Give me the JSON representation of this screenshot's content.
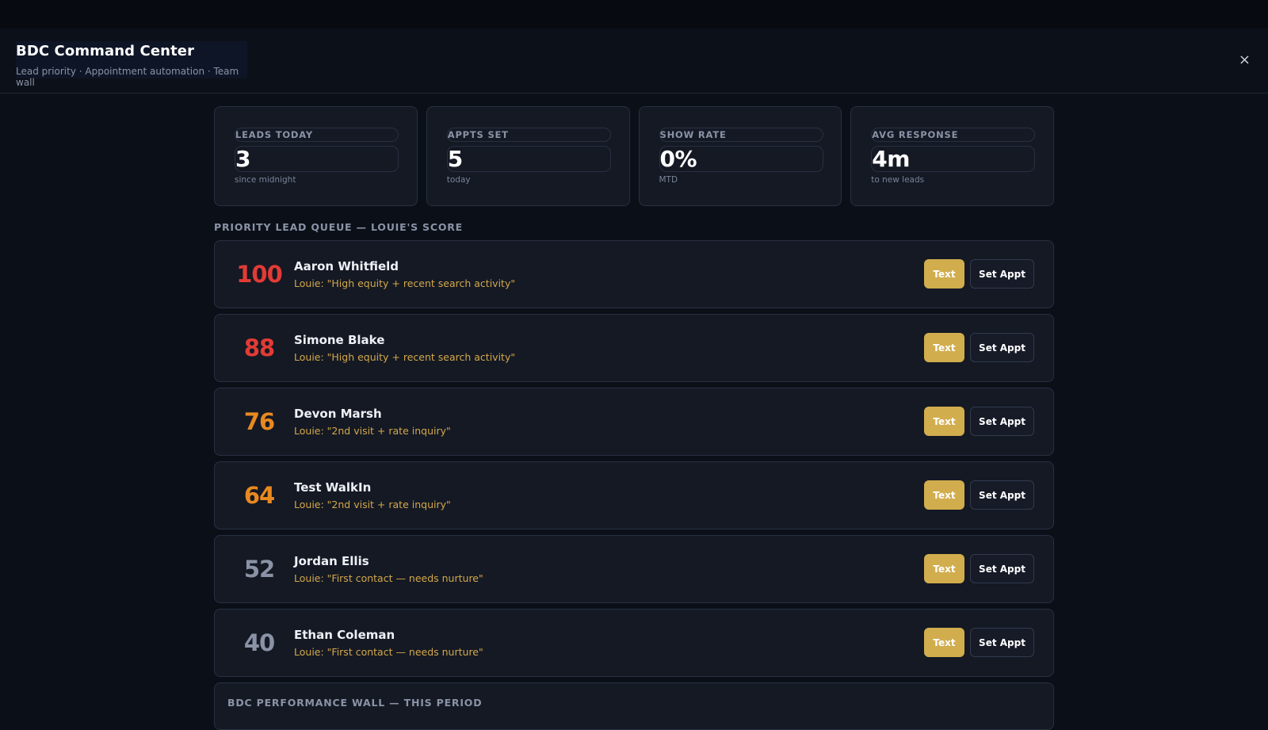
{
  "header": {
    "title": "BDC Command Center",
    "subtitle": "Lead priority · Appointment automation · Team wall",
    "close_icon": "×"
  },
  "stats": [
    {
      "label": "LEADS TODAY",
      "value": "3",
      "sub": "since midnight"
    },
    {
      "label": "APPTS SET",
      "value": "5",
      "sub": "today"
    },
    {
      "label": "SHOW RATE",
      "value": "0%",
      "sub": "MTD"
    },
    {
      "label": "AVG RESPONSE",
      "value": "4m",
      "sub": "to new leads"
    }
  ],
  "queue": {
    "title": "PRIORITY LEAD QUEUE — LOUIE'S SCORE",
    "text_label": "Text",
    "appt_label": "Set Appt",
    "leads": [
      {
        "score": "100",
        "name": "Aaron Whitfield",
        "note": "Louie: \"High equity + recent search activity\"",
        "color": "#e23b35"
      },
      {
        "score": "88",
        "name": "Simone Blake",
        "note": "Louie: \"High equity + recent search activity\"",
        "color": "#e23b35"
      },
      {
        "score": "76",
        "name": "Devon Marsh",
        "note": "Louie: \"2nd visit + rate inquiry\"",
        "color": "#e8891f"
      },
      {
        "score": "64",
        "name": "Test WalkIn",
        "note": "Louie: \"2nd visit + rate inquiry\"",
        "color": "#e8891f"
      },
      {
        "score": "52",
        "name": "Jordan Ellis",
        "note": "Louie: \"First contact — needs nurture\"",
        "color": "#8a93a6"
      },
      {
        "score": "40",
        "name": "Ethan Coleman",
        "note": "Louie: \"First contact — needs nurture\"",
        "color": "#8a93a6"
      }
    ]
  },
  "performance": {
    "title": "BDC PERFORMANCE WALL — THIS PERIOD"
  }
}
